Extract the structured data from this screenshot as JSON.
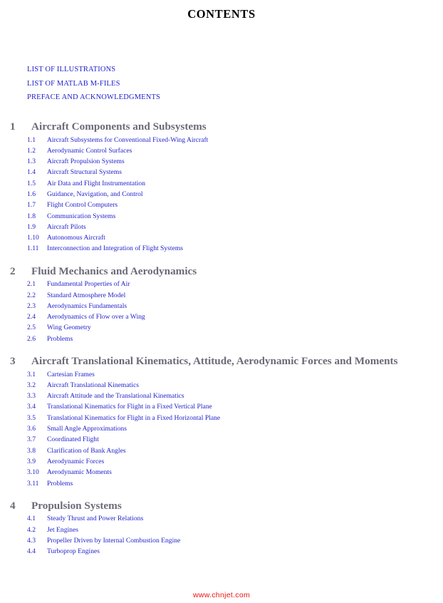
{
  "page": {
    "title": "CONTENTS",
    "watermark": "www.chnjet.com",
    "colors": {
      "title": "#000000",
      "chapter_heading": "#6b6b78",
      "section_text": "#2222cc",
      "frontmatter_text": "#2222cc",
      "watermark": "#ee1111",
      "background": "#ffffff"
    }
  },
  "frontmatter": [
    {
      "label": "LIST OF ILLUSTRATIONS"
    },
    {
      "label": "LIST OF MATLAB M-FILES"
    },
    {
      "label": "PREFACE AND ACKNOWLEDGMENTS"
    }
  ],
  "chapters": [
    {
      "number": "1",
      "title": "Aircraft Components and Subsystems",
      "sections": [
        {
          "number": "1.1",
          "title": "Aircraft Subsystems for Conventional Fixed-Wing Aircraft"
        },
        {
          "number": "1.2",
          "title": "Aerodynamic Control Surfaces"
        },
        {
          "number": "1.3",
          "title": "Aircraft Propulsion Systems"
        },
        {
          "number": "1.4",
          "title": "Aircraft Structural Systems"
        },
        {
          "number": "1.5",
          "title": "Air Data and Flight Instrumentation"
        },
        {
          "number": "1.6",
          "title": "Guidance, Navigation, and Control"
        },
        {
          "number": "1.7",
          "title": "Flight Control Computers"
        },
        {
          "number": "1.8",
          "title": "Communication Systems"
        },
        {
          "number": "1.9",
          "title": "Aircraft Pilots"
        },
        {
          "number": "1.10",
          "title": "Autonomous Aircraft"
        },
        {
          "number": "1.11",
          "title": "Interconnection and Integration of Flight Systems"
        }
      ]
    },
    {
      "number": "2",
      "title": "Fluid Mechanics and Aerodynamics",
      "sections": [
        {
          "number": "2.1",
          "title": "Fundamental Properties of Air"
        },
        {
          "number": "2.2",
          "title": "Standard Atmosphere Model"
        },
        {
          "number": "2.3",
          "title": "Aerodynamics Fundamentals"
        },
        {
          "number": "2.4",
          "title": "Aerodynamics of Flow over a Wing"
        },
        {
          "number": "2.5",
          "title": "Wing Geometry"
        },
        {
          "number": "2.6",
          "title": "Problems"
        }
      ]
    },
    {
      "number": "3",
      "title": "Aircraft Translational Kinematics, Attitude, Aerodynamic Forces and Moments",
      "sections": [
        {
          "number": "3.1",
          "title": "Cartesian Frames"
        },
        {
          "number": "3.2",
          "title": "Aircraft Translational Kinematics"
        },
        {
          "number": "3.3",
          "title": "Aircraft Attitude and the Translational Kinematics"
        },
        {
          "number": "3.4",
          "title": "Translational Kinematics for Flight in a Fixed Vertical Plane"
        },
        {
          "number": "3.5",
          "title": "Translational Kinematics for Flight in a Fixed Horizontal Plane"
        },
        {
          "number": "3.6",
          "title": "Small Angle Approximations"
        },
        {
          "number": "3.7",
          "title": "Coordinated Flight"
        },
        {
          "number": "3.8",
          "title": "Clarification of Bank Angles"
        },
        {
          "number": "3.9",
          "title": "Aerodynamic Forces"
        },
        {
          "number": "3.10",
          "title": "Aerodynamic Moments"
        },
        {
          "number": "3.11",
          "title": "Problems"
        }
      ]
    },
    {
      "number": "4",
      "title": "Propulsion Systems",
      "sections": [
        {
          "number": "4.1",
          "title": "Steady Thrust and Power Relations"
        },
        {
          "number": "4.2",
          "title": "Jet Engines"
        },
        {
          "number": "4.3",
          "title": "Propeller Driven by Internal Combustion Engine"
        },
        {
          "number": "4.4",
          "title": "Turboprop Engines"
        }
      ]
    }
  ]
}
